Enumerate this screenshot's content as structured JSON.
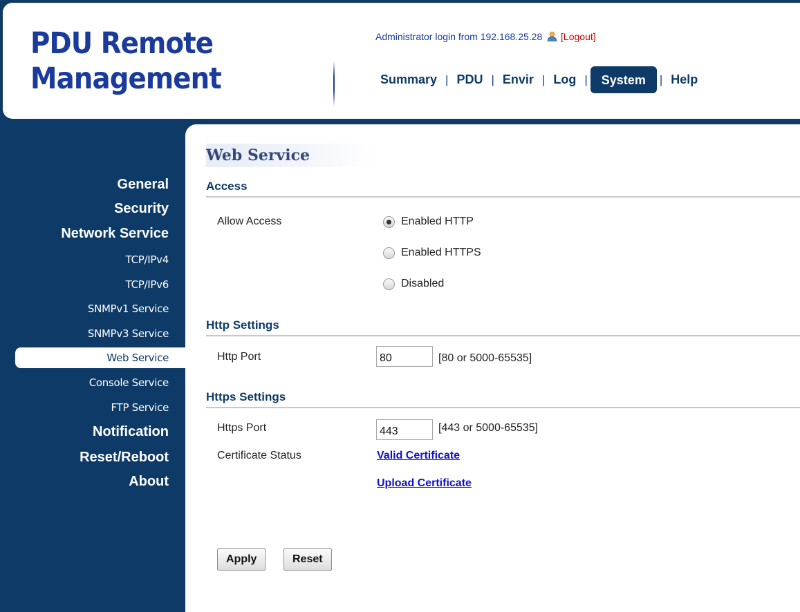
{
  "header": {
    "logo_line1": "PDU Remote",
    "logo_line2": "Management",
    "login_text": "Administrator login from 192.168.25.28",
    "logout_label": "[Logout]",
    "nav": [
      {
        "label": "Summary"
      },
      {
        "label": "PDU"
      },
      {
        "label": "Envir"
      },
      {
        "label": "Log"
      },
      {
        "label": "System",
        "active": true
      },
      {
        "label": "Help"
      }
    ],
    "nav_separator": "|"
  },
  "sidebar": {
    "items": [
      {
        "label": "General"
      },
      {
        "label": "Security"
      },
      {
        "label": "Network Service"
      },
      {
        "label": "TCP/IPv4"
      },
      {
        "label": "TCP/IPv6"
      },
      {
        "label": "SNMPv1 Service"
      },
      {
        "label": "SNMPv3 Service"
      },
      {
        "label": "Web Service",
        "active": true
      },
      {
        "label": "Console Service"
      },
      {
        "label": "FTP Service"
      },
      {
        "label": "Notification"
      },
      {
        "label": "Reset/Reboot"
      },
      {
        "label": "About"
      }
    ]
  },
  "content": {
    "title": "Web Service",
    "access": {
      "section_title": "Access",
      "allow_label": "Allow Access",
      "options": [
        {
          "label": "Enabled HTTP",
          "checked": true
        },
        {
          "label": "Enabled HTTPS",
          "checked": false
        },
        {
          "label": "Disabled",
          "checked": false
        }
      ]
    },
    "http": {
      "section_title": "Http Settings",
      "port_label": "Http Port",
      "port_value": "80",
      "port_hint": "[80 or 5000-65535]"
    },
    "https": {
      "section_title": "Https Settings",
      "port_label": "Https Port",
      "port_value": "443",
      "port_hint": "[443 or 5000-65535]",
      "cert_label": "Certificate Status",
      "cert_status_link": "Valid Certificate",
      "upload_link": "Upload Certificate"
    },
    "apply_label": "Apply",
    "reset_label": "Reset"
  },
  "colors": {
    "primary_navy": "#0d3a66",
    "logo_blue": "#1a3b9c",
    "logout_red": "#d00000",
    "link_blue": "#1010cc"
  },
  "icons": {
    "user": "user-icon"
  }
}
